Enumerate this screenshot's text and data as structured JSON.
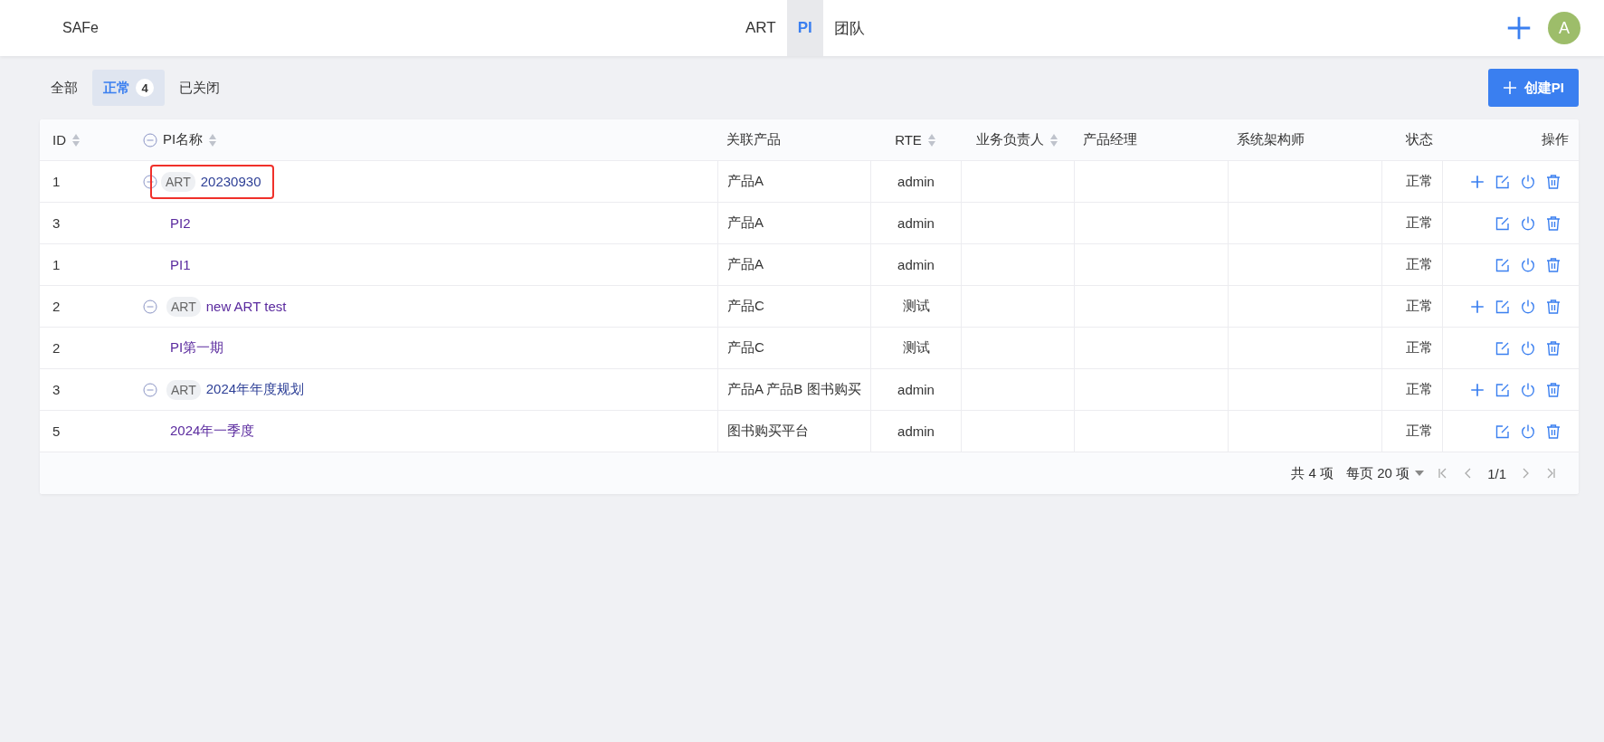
{
  "app": {
    "title": "SAFe"
  },
  "nav": [
    {
      "label": "ART",
      "selected": false
    },
    {
      "label": "PI",
      "selected": true
    },
    {
      "label": "团队",
      "selected": false
    }
  ],
  "user": {
    "avatar_letter": "A"
  },
  "filters": [
    {
      "label": "全部",
      "selected": false
    },
    {
      "label": "正常",
      "count": "4",
      "selected": true
    },
    {
      "label": "已关闭",
      "selected": false
    }
  ],
  "create_button": {
    "label": "创建PI"
  },
  "table": {
    "columns": [
      {
        "label": "ID",
        "sortable": true
      },
      {
        "label": "PI名称",
        "sortable": true,
        "collapse_all": true
      },
      {
        "label": "关联产品"
      },
      {
        "label": "RTE",
        "sortable": true
      },
      {
        "label": "业务负责人",
        "sortable": true
      },
      {
        "label": "产品经理"
      },
      {
        "label": "系统架构师"
      },
      {
        "label": "状态"
      },
      {
        "label": "操作"
      }
    ],
    "rows": [
      {
        "id": "1",
        "tag": "ART",
        "name": "20230930",
        "visited": false,
        "highlighted": true,
        "expanded": true,
        "product": "产品A",
        "rte": "admin",
        "status": "正常",
        "can_add": true,
        "children": [
          {
            "id": "3",
            "name": "PI2",
            "visited": true,
            "product": "产品A",
            "rte": "admin",
            "status": "正常",
            "can_add": false
          },
          {
            "id": "1",
            "name": "PI1",
            "visited": true,
            "product": "产品A",
            "rte": "admin",
            "status": "正常",
            "can_add": false
          }
        ]
      },
      {
        "id": "2",
        "tag": "ART",
        "name": "new ART test",
        "visited": true,
        "highlighted": false,
        "expanded": true,
        "product": "产品C",
        "rte": "测试",
        "status": "正常",
        "can_add": true,
        "children": [
          {
            "id": "2",
            "name": "PI第一期",
            "visited": true,
            "product": "产品C",
            "rte": "测试",
            "status": "正常",
            "can_add": false
          }
        ]
      },
      {
        "id": "3",
        "tag": "ART",
        "name": "2024年年度规划",
        "visited": false,
        "highlighted": false,
        "expanded": true,
        "product": "产品A 产品B 图书购买",
        "rte": "admin",
        "status": "正常",
        "can_add": true,
        "children": [
          {
            "id": "5",
            "name": "2024年一季度",
            "visited": true,
            "product": "图书购买平台",
            "rte": "admin",
            "status": "正常",
            "can_add": false
          }
        ]
      }
    ]
  },
  "pagination": {
    "total": "共 4 项",
    "page_size": "每页 20 项",
    "page": "1/1"
  }
}
